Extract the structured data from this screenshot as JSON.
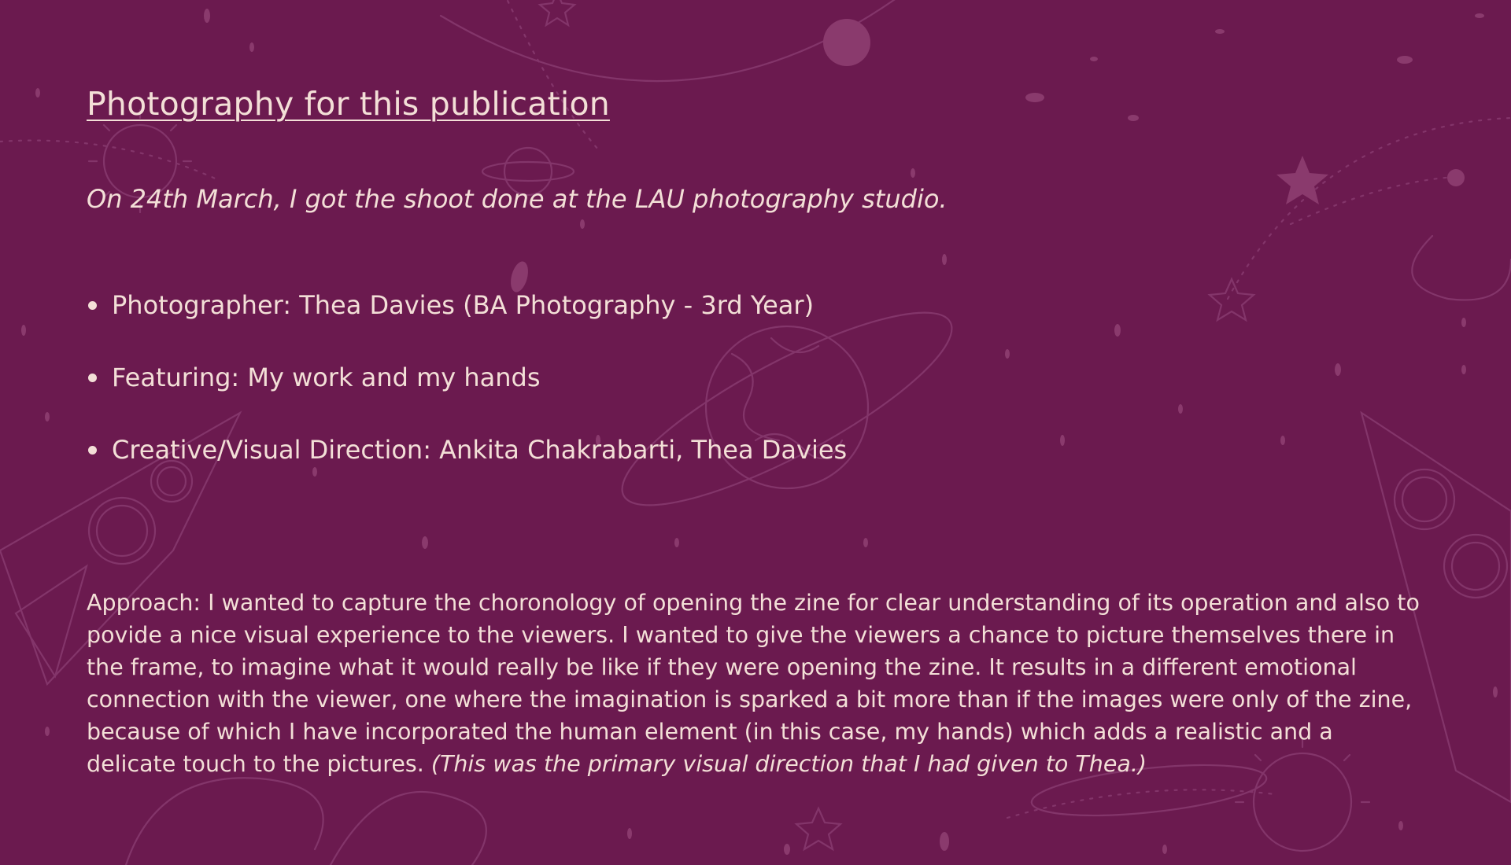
{
  "slide": {
    "title": "Photography for this publication",
    "intro": "On 24th March, I got the shoot done at the LAU photography studio.",
    "bullets": [
      {
        "label": "Photographer: Thea Davies (BA Photography - 3rd Year)"
      },
      {
        "label": "Featuring: My work and my hands"
      },
      {
        "label": "Creative/Visual Direction: Ankita Chakrabarti, Thea Davies"
      }
    ],
    "approach": {
      "text": "Approach: I wanted to capture the choronology of opening the zine for clear understanding of its operation and also to povide a nice visual experience to the viewers. I wanted to give the viewers a chance to picture themselves there in the frame, to imagine what it would really be like if they were opening the zine. It results in a different emotional connection with the viewer, one where the imagination is sparked a bit more than if the images were only of the zine, because of which I have incorporated the human element (in this case, my hands) which adds a realistic and a delicate touch to the pictures.",
      "note": "(This was the primary visual direction that I had given to Thea.)"
    }
  },
  "theme": {
    "background": "#6b1a4f",
    "text": "#f3dfd7",
    "doodle": "#8a3a6d"
  },
  "icons": [
    "rocket-doodle",
    "planet-doodle",
    "sun-doodle",
    "star-doodle",
    "comet-doodle"
  ]
}
